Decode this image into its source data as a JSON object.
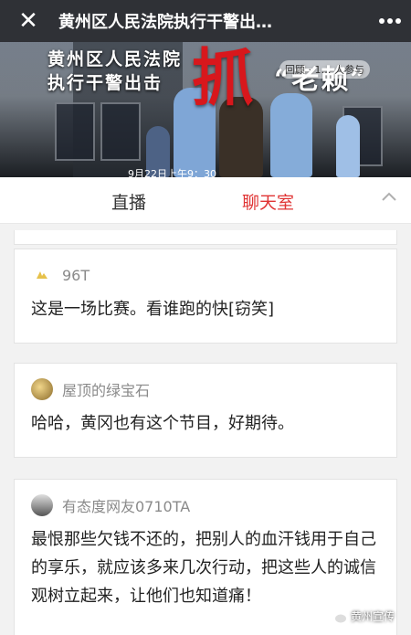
{
  "header": {
    "title": "黄州区人民法院执行干警出…",
    "close_icon": "close-icon",
    "more_icon": "more-icon"
  },
  "hero": {
    "line1": "黄州区人民法院",
    "line2": "执行干警出击",
    "big_char": "抓",
    "quote": "“老赖”",
    "replay_badge": "回顾 · 1… 人参与",
    "date": "9月22日上午9：30"
  },
  "tabs": {
    "live": "直播",
    "chat": "聊天室",
    "active": "chat",
    "accent_color": "#e03434"
  },
  "messages": [
    {
      "user": "96T",
      "text": "这是一场比赛。看谁跑的快[窃笑]"
    },
    {
      "user": "屋顶的绿宝石",
      "text": "哈哈，黄冈也有这个节目，好期待。"
    },
    {
      "user": "有态度网友0710TA",
      "text": "最恨那些欠钱不还的，把别人的血汗钱用于自己的享乐，就应该多来几次行动，把这些人的诚信观树立起来，让他们也知道痛！"
    }
  ],
  "watermark": {
    "text": "黄州宣传"
  }
}
